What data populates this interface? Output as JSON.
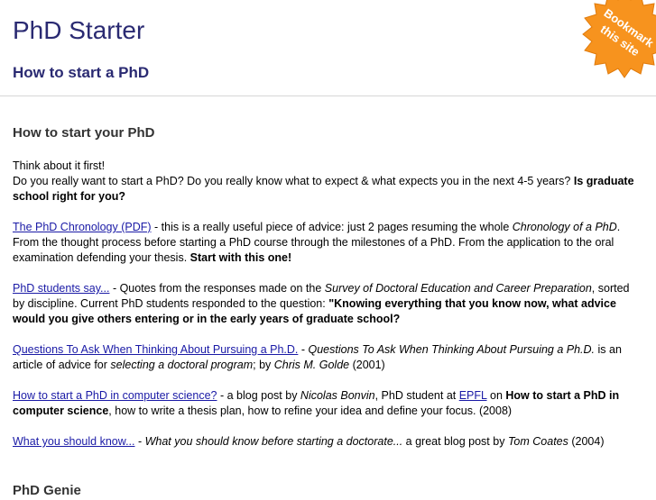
{
  "header": {
    "title": "PhD Starter",
    "subtitle": "How to start a PhD"
  },
  "badge": {
    "line1": "Bookmark",
    "line2": "this site",
    "color": "#f7931e"
  },
  "main": {
    "heading": "How to start your PhD",
    "intro": {
      "line1": "Think about it first!",
      "line2": "Do you really want to start a PhD? Do you really know what to expect & what expects you in the next 4-5 years?",
      "bold": "Is graduate school right for you?"
    },
    "items": [
      {
        "link": "The PhD Chronology (PDF)",
        "t1": " - this is a really useful piece of advice: just 2 pages resuming the whole ",
        "i1": "Chronology of a PhD",
        "t2": ". From the thought process before starting a PhD course through the milestones of a PhD. From the application to the oral examination defending your thesis. ",
        "b1": "Start with this one!"
      },
      {
        "link": "PhD students say...",
        "t1": " - Quotes from the responses made on the ",
        "i1": "Survey of Doctoral Education and Career Preparation",
        "t2": ", sorted by discipline. Current PhD students responded to the question: ",
        "b1": "\"Knowing everything that you know now, what advice would you give others entering or in the early years of graduate school?"
      },
      {
        "link": "Questions To Ask When Thinking About Pursuing a Ph.D.",
        "t1": " - ",
        "i1": "Questions To Ask When Thinking About Pursuing a Ph.D.",
        "t2": " is an article of advice for ",
        "i2": "selecting a doctoral program",
        "t3": "; by ",
        "i3": "Chris M. Golde",
        "t4": " (2001)"
      },
      {
        "link": "How to start a PhD in computer science?",
        "t1": " - a blog post by ",
        "i1": "Nicolas Bonvin",
        "t2": ", PhD student at ",
        "link2": "EPFL",
        "t3": " on ",
        "b1": "How to start a PhD in computer science",
        "t4": ", how to write a thesis plan, how to refine your idea and define your focus. (2008)"
      },
      {
        "link": "What you should know...",
        "t1": " - ",
        "i1": "What you should know before starting a doctorate...",
        "t2": " a great blog post by ",
        "i2": "Tom Coates",
        "t3": " (2004)"
      }
    ],
    "next_heading": "PhD Genie"
  }
}
